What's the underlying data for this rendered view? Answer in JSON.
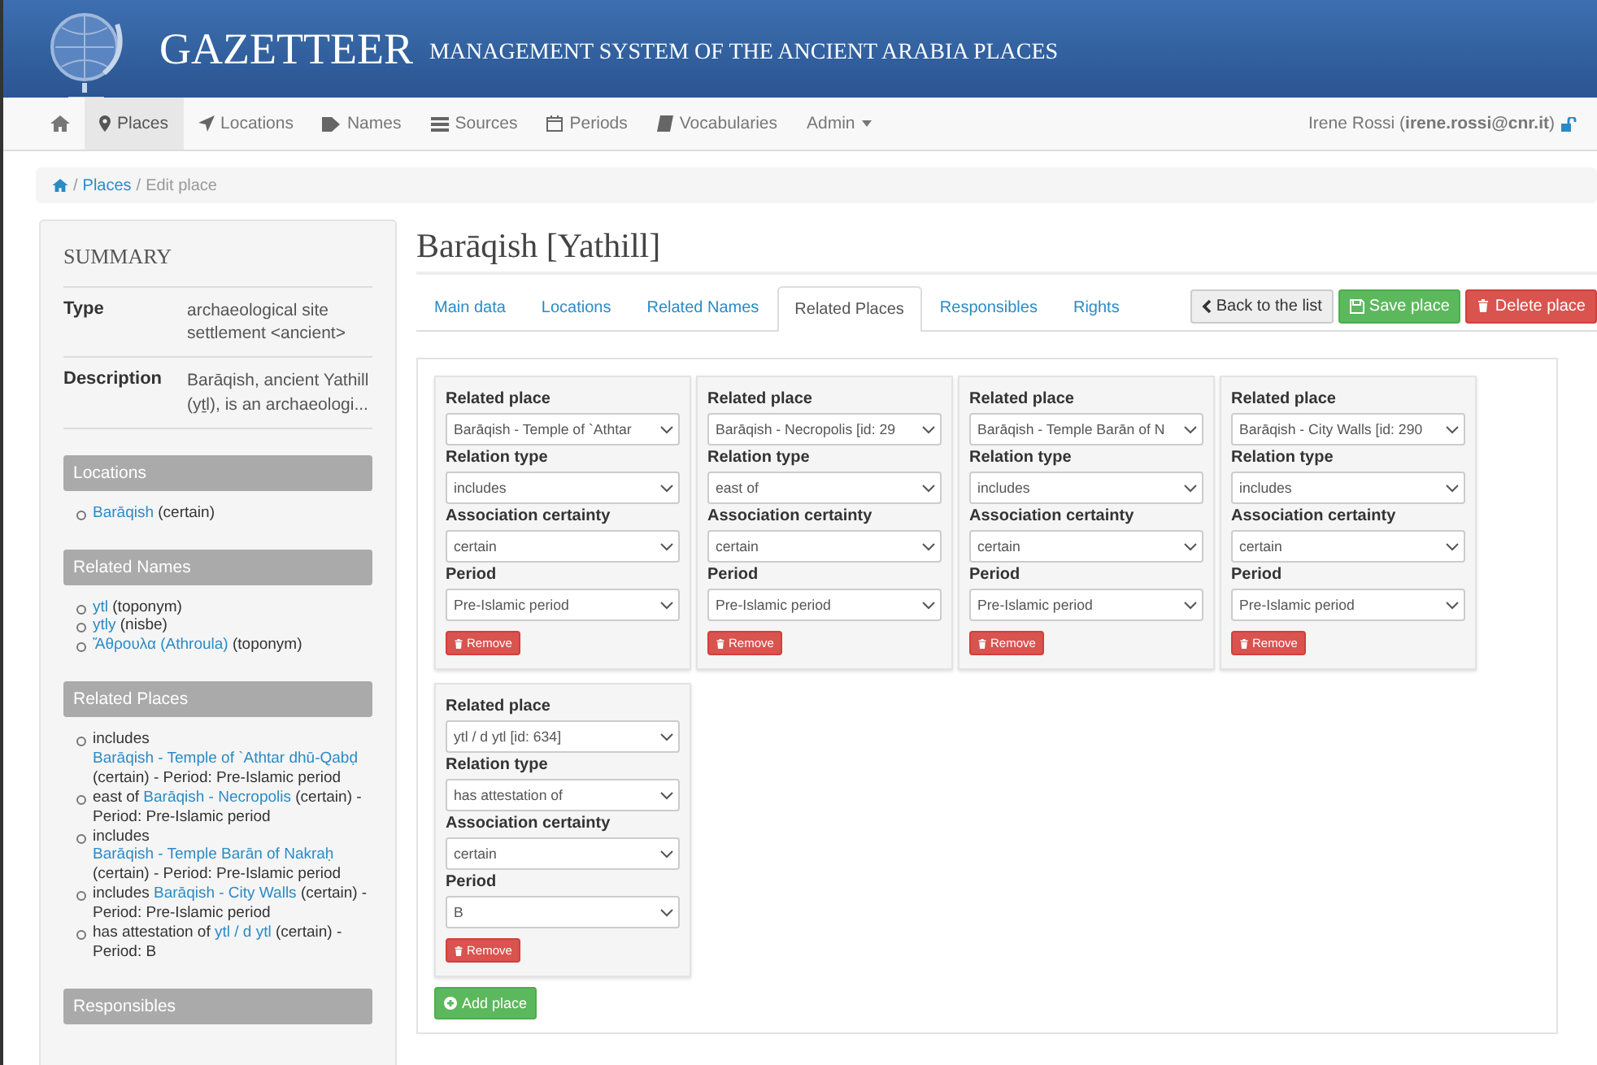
{
  "header": {
    "title": "GAZETTEER",
    "subtitle": "MANAGEMENT SYSTEM OF THE ANCIENT ARABIA PLACES"
  },
  "nav": {
    "items": [
      {
        "label": "Places",
        "selected": true
      },
      {
        "label": "Locations",
        "selected": false
      },
      {
        "label": "Names",
        "selected": false
      },
      {
        "label": "Sources",
        "selected": false
      },
      {
        "label": "Periods",
        "selected": false
      },
      {
        "label": "Vocabularies",
        "selected": false
      }
    ],
    "admin": "Admin",
    "user": "Irene Rossi (**irene.rossi@cnr.it**)"
  },
  "breadcrumb": {
    "separators": [
      "/",
      "/"
    ],
    "link": "Places",
    "current": "Edit place"
  },
  "summary": {
    "title": "SUMMARY",
    "rows": [
      {
        "label": "Type",
        "lines": [
          "archaeological site",
          "settlement <ancient>"
        ]
      },
      {
        "label": "Description",
        "lines": [
          "Barāqish, ancient Yathill",
          "(yṯl), is an archaeologi..."
        ]
      }
    ],
    "sections": [
      {
        "title": "Locations",
        "items": [
          {
            "link": "Barāqish",
            "after": " (certain)"
          }
        ]
      },
      {
        "title": "Related Names",
        "items": [
          {
            "link": "ytl",
            "after": " (toponym)"
          },
          {
            "link": "ytly",
            "after": " (nisbe)"
          },
          {
            "link": "Ἄθρουλα (Athroula)",
            "after": " (toponym)"
          }
        ]
      },
      {
        "title": "Related Places",
        "items": [
          {
            "before": "includes ",
            "link": "Barāqish - Temple of `Athtar dhū-Qabḍ",
            "after": " (certain) - Period: Pre-Islamic period"
          },
          {
            "before": "east of ",
            "link": "Barāqish - Necropolis",
            "after": " (certain) - Period: Pre-Islamic period"
          },
          {
            "before": "includes ",
            "link": "Barāqish - Temple Barān of Nakraḥ",
            "after": " (certain) - Period: Pre-Islamic period"
          },
          {
            "before": "includes ",
            "link": "Barāqish - City Walls",
            "after": " (certain) - Period: Pre-Islamic period"
          },
          {
            "before": "has attestation of ",
            "link": "ytl / d ytl",
            "after": " (certain) - Period: B"
          }
        ]
      },
      {
        "title": "Responsibles"
      }
    ]
  },
  "main": {
    "title": "Barāqish [Yathill]",
    "tabs": [
      {
        "label": "Main data",
        "selected": false
      },
      {
        "label": "Locations",
        "selected": false
      },
      {
        "label": "Related Names",
        "selected": false
      },
      {
        "label": "Related Places",
        "selected": true
      },
      {
        "label": "Responsibles",
        "selected": false
      },
      {
        "label": "Rights",
        "selected": false
      }
    ],
    "buttons": [
      {
        "kind": "back",
        "label": "Back to the list"
      },
      {
        "kind": "save",
        "label": "Save place"
      },
      {
        "kind": "delete",
        "label": "Delete place"
      }
    ],
    "cards": [
      {
        "fields": [
          {
            "label": "Related place",
            "value": "Barāqish - Temple of `Athtar"
          },
          {
            "label": "Relation type",
            "value": "includes"
          },
          {
            "label": "Association certainty",
            "value": "certain"
          },
          {
            "label": "Period",
            "value": "Pre-Islamic period"
          }
        ],
        "remove": "Remove"
      },
      {
        "fields": [
          {
            "label": "Related place",
            "value": "Barāqish - Necropolis [id: 29"
          },
          {
            "label": "Relation type",
            "value": "east of"
          },
          {
            "label": "Association certainty",
            "value": "certain"
          },
          {
            "label": "Period",
            "value": "Pre-Islamic period"
          }
        ],
        "remove": "Remove"
      },
      {
        "fields": [
          {
            "label": "Related place",
            "value": "Barāqish - Temple Barān of N"
          },
          {
            "label": "Relation type",
            "value": "includes"
          },
          {
            "label": "Association certainty",
            "value": "certain"
          },
          {
            "label": "Period",
            "value": "Pre-Islamic period"
          }
        ],
        "remove": "Remove"
      },
      {
        "fields": [
          {
            "label": "Related place",
            "value": "Barāqish - City Walls [id: 290"
          },
          {
            "label": "Relation type",
            "value": "includes"
          },
          {
            "label": "Association certainty",
            "value": "certain"
          },
          {
            "label": "Period",
            "value": "Pre-Islamic period"
          }
        ],
        "remove": "Remove"
      },
      {
        "fields": [
          {
            "label": "Related place",
            "value": "ytl / d ytl [id: 634]"
          },
          {
            "label": "Relation type",
            "value": "has attestation of"
          },
          {
            "label": "Association certainty",
            "value": "certain"
          },
          {
            "label": "Period",
            "value": "B"
          }
        ],
        "remove": "Remove"
      }
    ],
    "add": "Add place"
  }
}
